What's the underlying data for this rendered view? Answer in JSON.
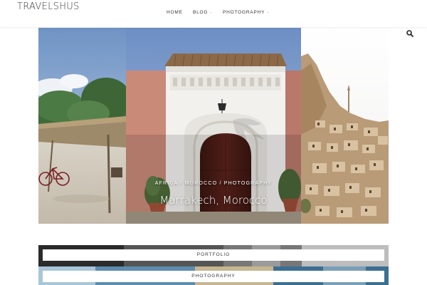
{
  "header": {
    "logo": "TRAVELSHUS",
    "nav": [
      {
        "label": "HOME",
        "has_dropdown": false
      },
      {
        "label": "BLOG",
        "has_dropdown": true
      },
      {
        "label": "PHOTOGRAPHY",
        "has_dropdown": true
      }
    ],
    "search_icon": "search-icon"
  },
  "slider": {
    "slides": [
      {
        "image": "beach-hut-bicycle"
      },
      {
        "image": "moroccan-arched-doorway",
        "categories": "AFRICA / MOROCCO / PHOTOGRAPHY",
        "title": "Marrakech, Morocco"
      },
      {
        "image": "cappadocia-cave-town"
      }
    ]
  },
  "categories": [
    {
      "label": "PORTFOLIO"
    },
    {
      "label": "PHOTOGRAPHY"
    }
  ],
  "colors": {
    "accent_text": "#333333",
    "caption_text": "#ffffff",
    "background": "#ffffff"
  }
}
